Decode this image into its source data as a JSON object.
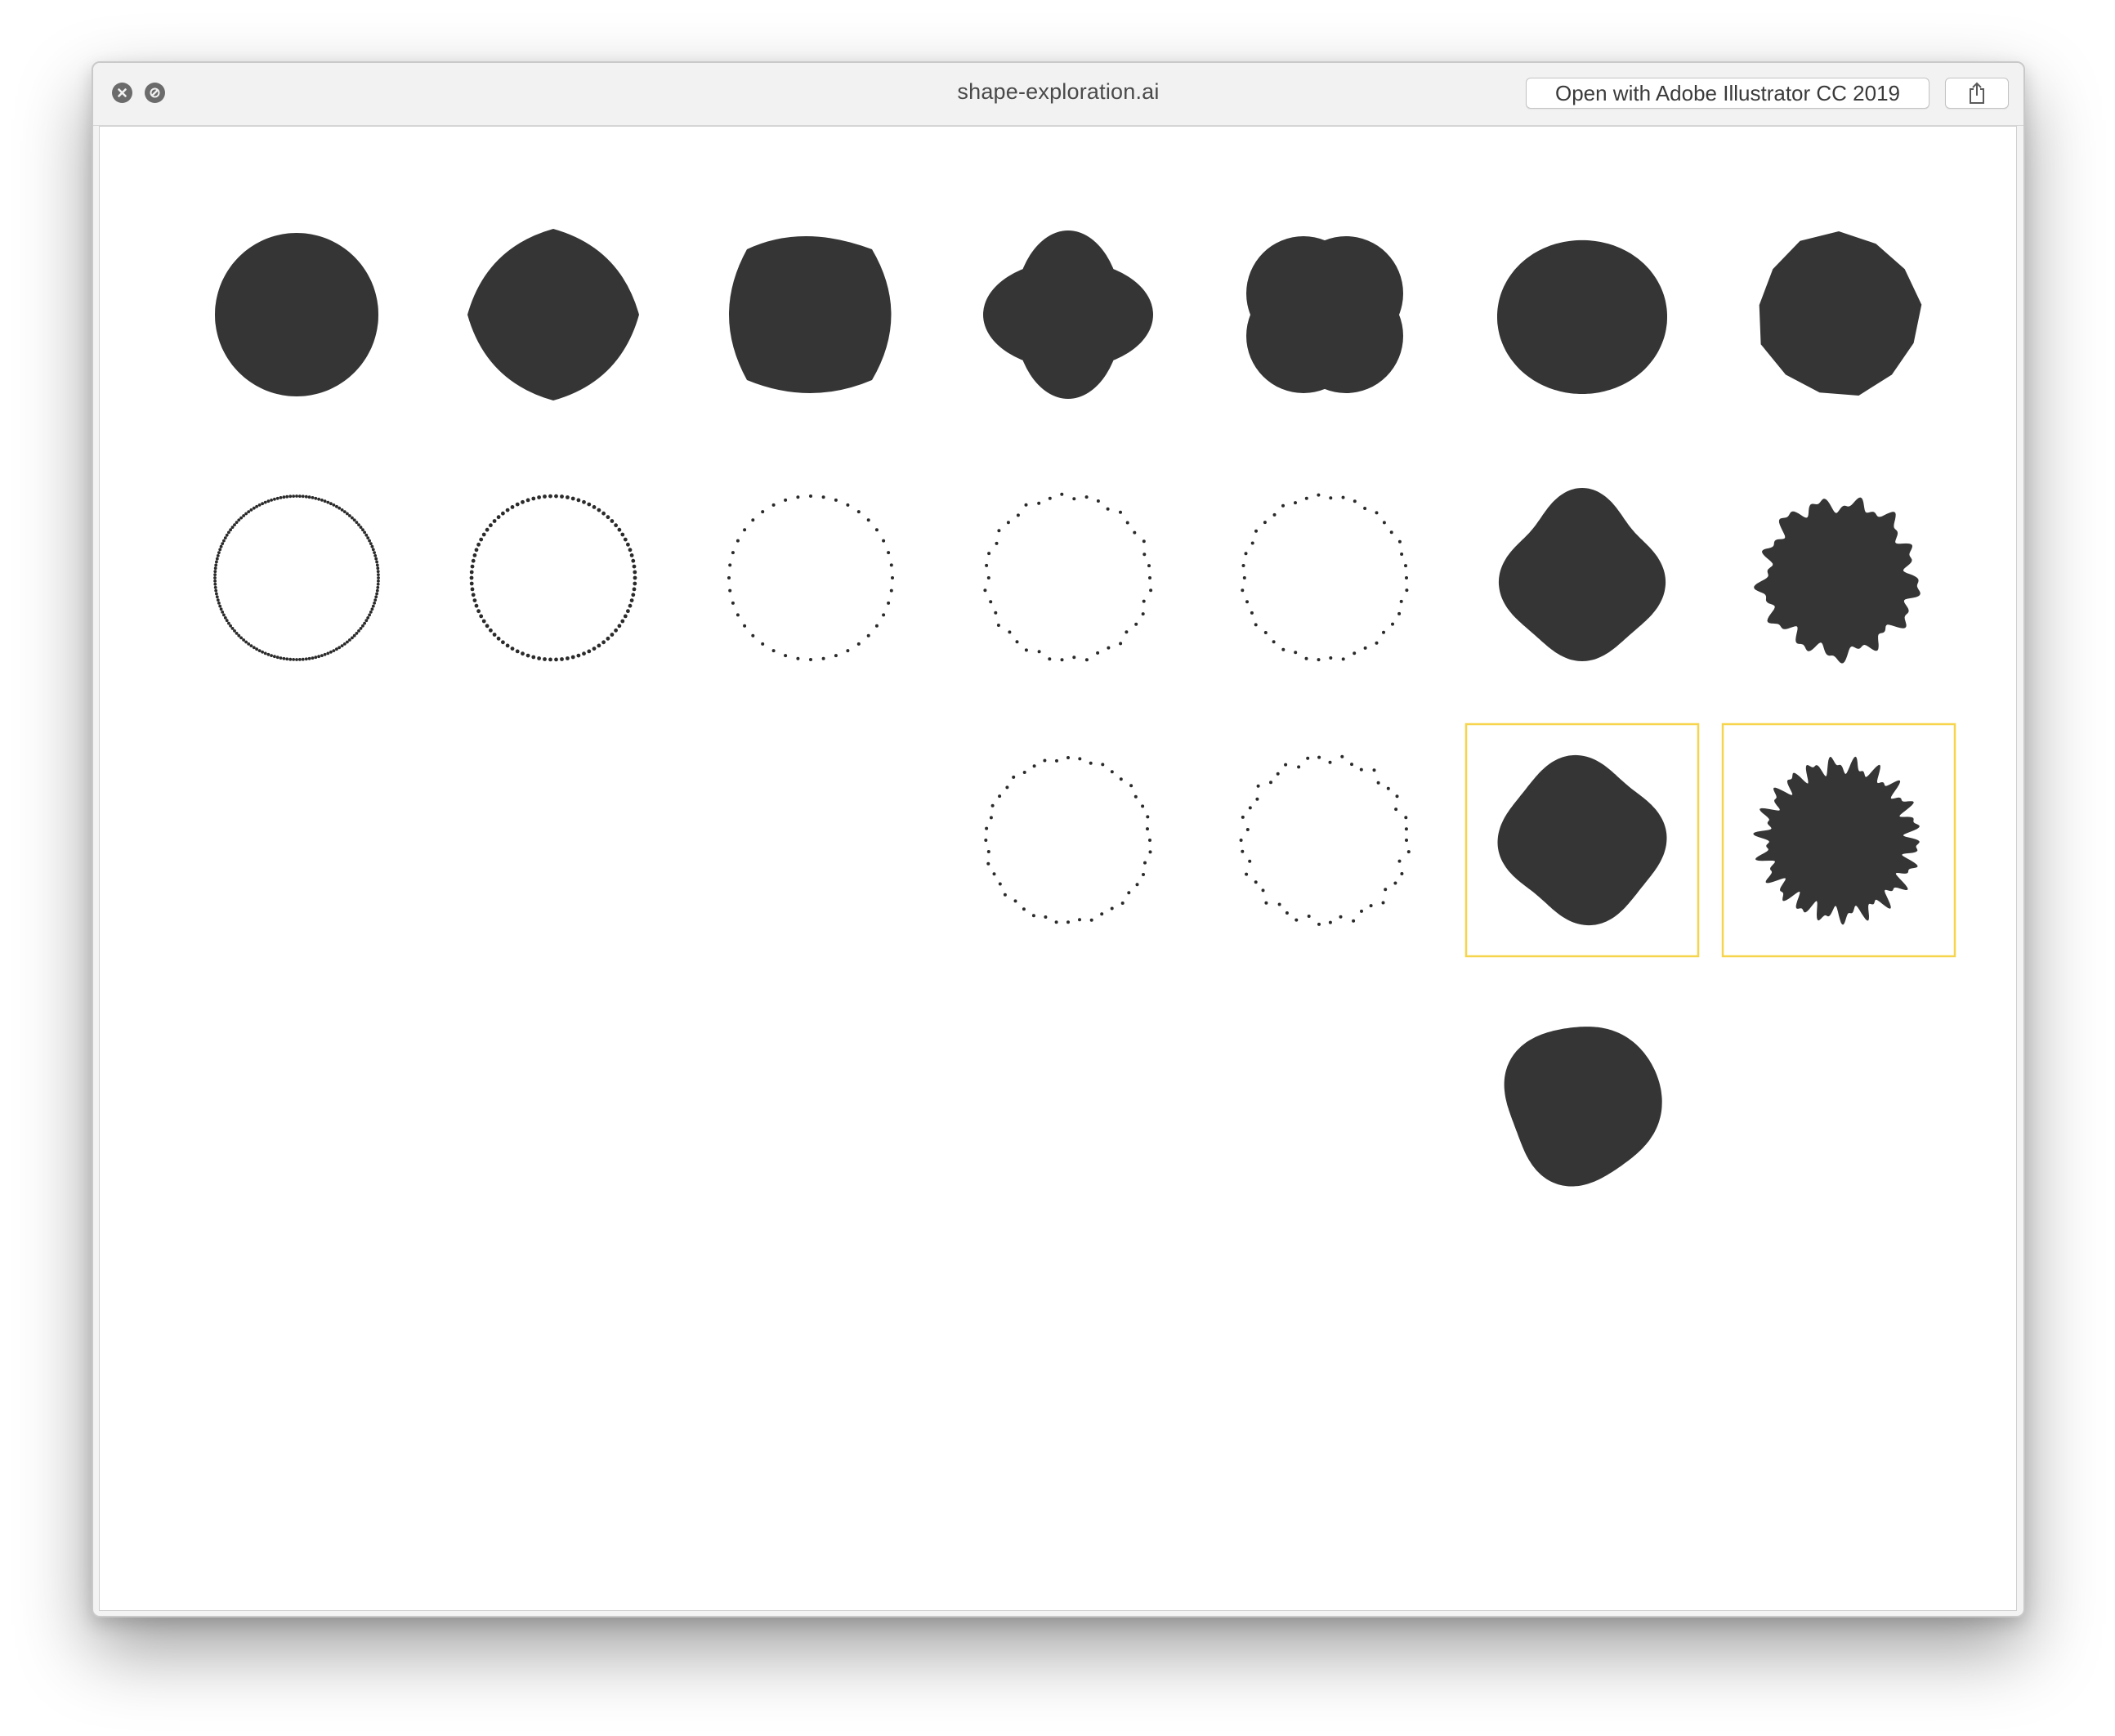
{
  "window": {
    "title": "shape-exploration.ai",
    "open_with_label": "Open with Adobe Illustrator CC 2019"
  },
  "icons": {
    "close": "close-icon",
    "minimize": "minimize-icon",
    "share": "share-icon"
  },
  "colors": {
    "shape_fill": "#363536",
    "selection": "#f6d54c",
    "dots": "#2a2a2a"
  },
  "artwork": {
    "rows": [
      [
        "solid",
        "solid",
        "solid",
        "solid",
        "solid",
        "solid",
        "solid"
      ],
      [
        "dotted",
        "dotted",
        "dotted",
        "dotted",
        "dotted",
        "solid",
        "solid"
      ],
      [
        "empty",
        "empty",
        "empty",
        "dotted",
        "dotted",
        "solid-selected",
        "solid-selected"
      ],
      [
        "empty",
        "empty",
        "empty",
        "empty",
        "empty",
        "solid",
        "empty"
      ]
    ]
  }
}
